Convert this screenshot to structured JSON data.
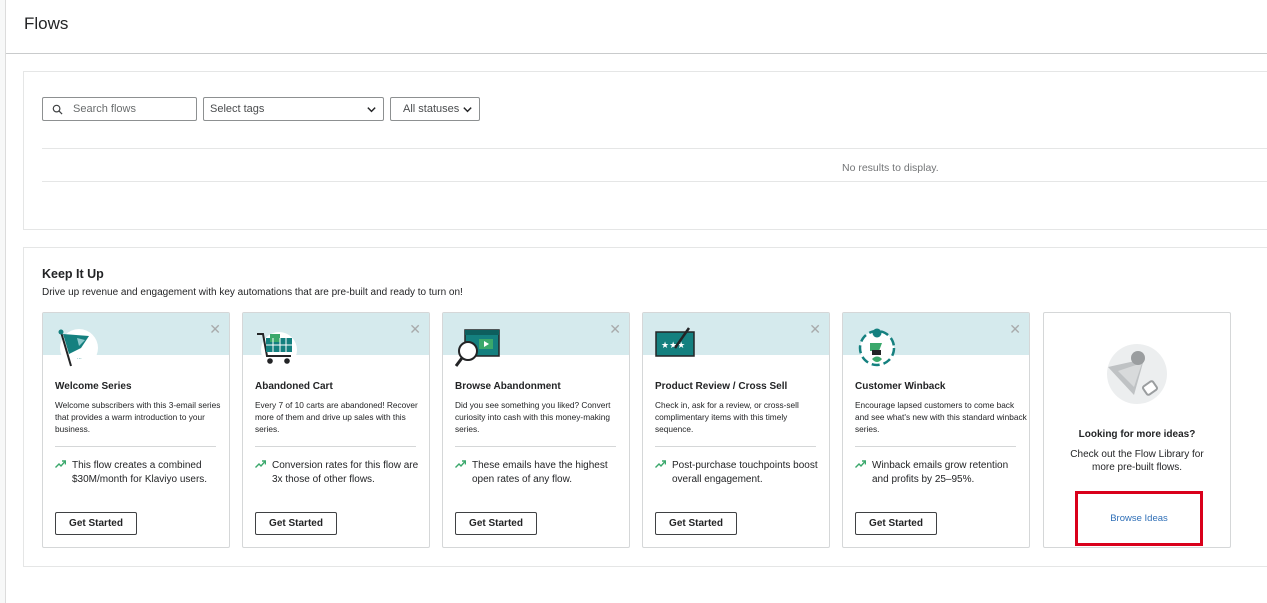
{
  "header": {
    "title": "Flows"
  },
  "filters": {
    "search_placeholder": "Search flows",
    "tags_label": "Select tags",
    "status_label": "All statuses"
  },
  "results": {
    "empty_text": "No results to display."
  },
  "keep": {
    "title": "Keep It Up",
    "subtitle": "Drive up revenue and engagement with key automations that are pre-built and ready to turn on!",
    "cards": [
      {
        "title": "Welcome Series",
        "desc": "Welcome subscribers with this 3-email series that provides a warm introduction to your business.",
        "stat": "This flow creates a combined $30M/month for Klaviyo users.",
        "cta": "Get Started",
        "icon": "flag-icon"
      },
      {
        "title": "Abandoned Cart",
        "desc": "Every 7 of 10 carts are abandoned! Recover more of them and drive up sales with this series.",
        "stat": "Conversion rates for this flow are 3x those of other flows.",
        "cta": "Get Started",
        "icon": "cart-icon"
      },
      {
        "title": "Browse Abandonment",
        "desc": "Did you see something you liked? Convert curiosity into cash with this money-making series.",
        "stat": "These emails have the highest open rates of any flow.",
        "cta": "Get Started",
        "icon": "magnifier-browser-icon"
      },
      {
        "title": "Product Review / Cross Sell",
        "desc": "Check in, ask for a review, or cross-sell complimentary items with this timely sequence.",
        "stat": "Post-purchase touchpoints boost overall engagement.",
        "cta": "Get Started",
        "icon": "review-stars-icon"
      },
      {
        "title": "Customer Winback",
        "desc": "Encourage lapsed customers to come back and see what's new with this standard winback series.",
        "stat": "Winback emails grow retention and profits by 25–95%.",
        "cta": "Get Started",
        "icon": "winback-icon"
      }
    ],
    "more": {
      "title": "Looking for more ideas?",
      "desc": "Check out the Flow Library for more pre-built flows.",
      "link": "Browse Ideas"
    }
  },
  "colors": {
    "card_top": "#d5eaed",
    "teal": "#14807f",
    "trend_green": "#3aa86b",
    "link_blue": "#2f6fb7",
    "highlight_red": "#d9001b"
  }
}
